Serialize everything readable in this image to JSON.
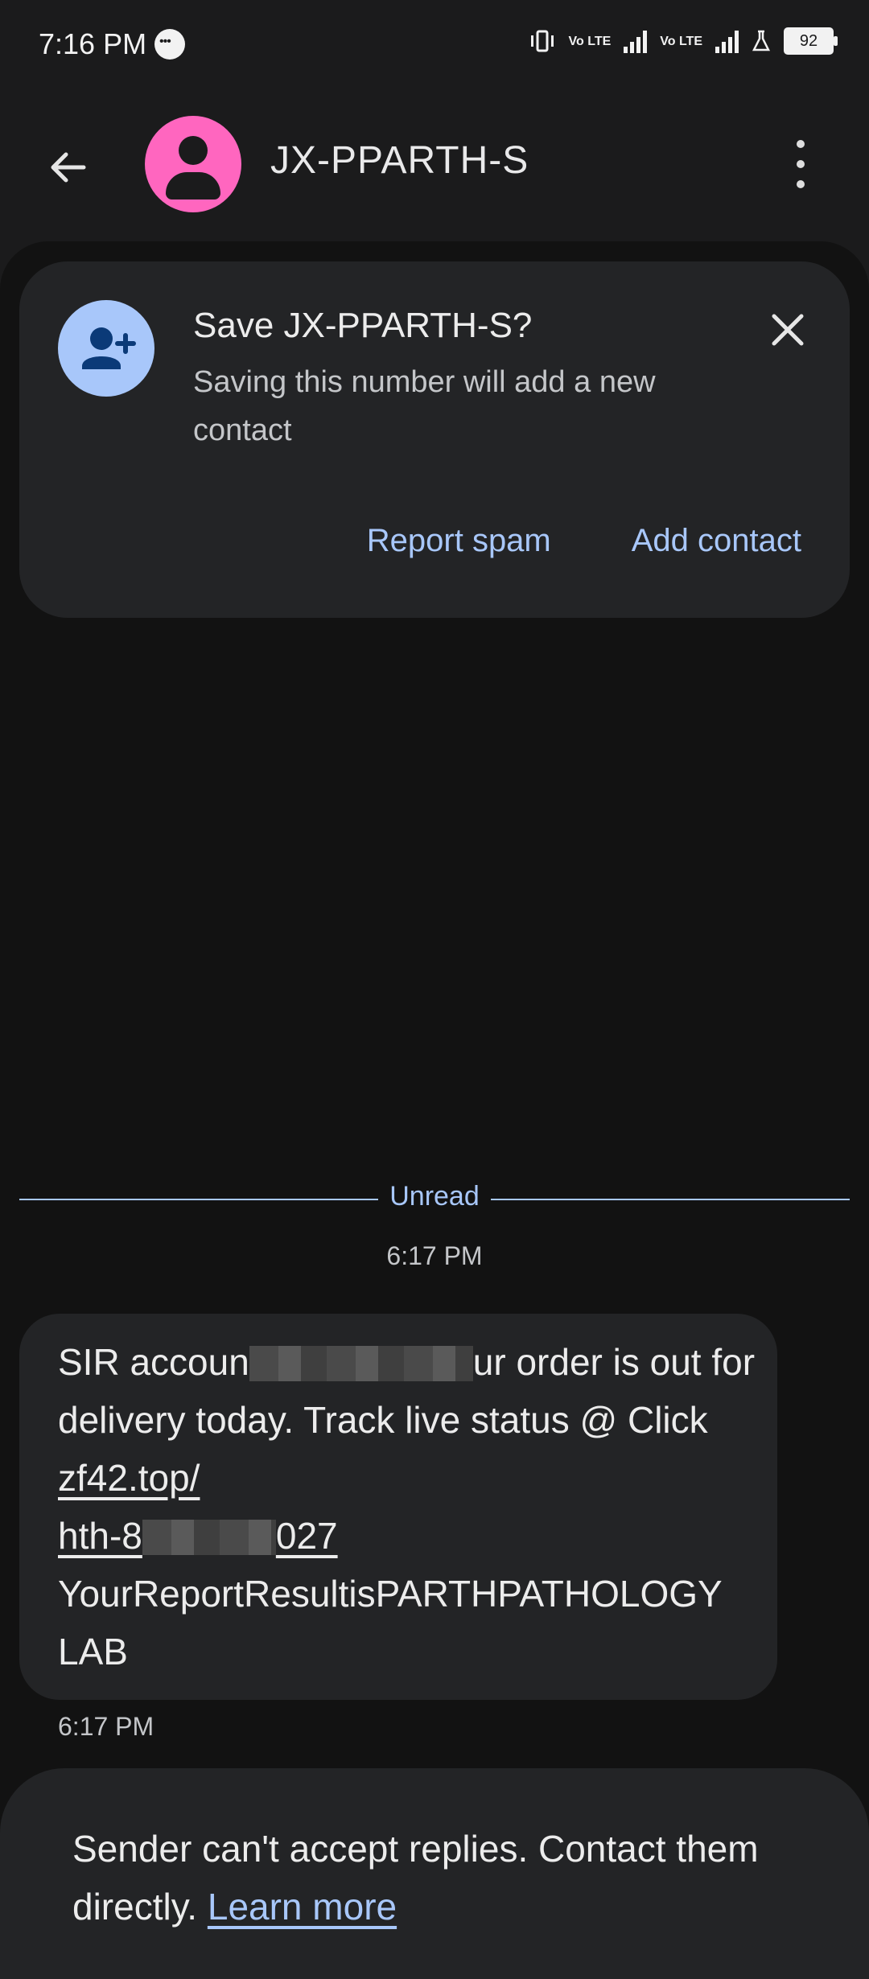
{
  "status_bar": {
    "time": "7:16 PM",
    "volte_1": "Vo LTE",
    "volte_2": "Vo LTE",
    "battery": "92"
  },
  "header": {
    "title": "JX-PPARTH-S",
    "avatar_color": "#ff66bf"
  },
  "save_card": {
    "title": "Save JX-PPARTH-S?",
    "subtitle": "Saving this number will add a new contact",
    "report_spam": "Report spam",
    "add_contact": "Add contact"
  },
  "divider": {
    "label": "Unread"
  },
  "conversation": {
    "timestamp_top": "6:17 PM",
    "message": {
      "part_1": "SIR accoun",
      "part_2": "ur order is out for delivery today. Track live status @ Click ",
      "link_1": "zf42.top/",
      "link_2a": "hth-8",
      "link_2b": "027",
      "part_3": "YourReportResultisPARTHPATHOLOGY LAB"
    },
    "timestamp_bottom": "6:17 PM"
  },
  "footer": {
    "text": "Sender can't accept replies. Contact them directly. ",
    "link": "Learn more"
  },
  "colors": {
    "accent": "#a8c7fa",
    "background": "#121212",
    "card": "#232426"
  }
}
